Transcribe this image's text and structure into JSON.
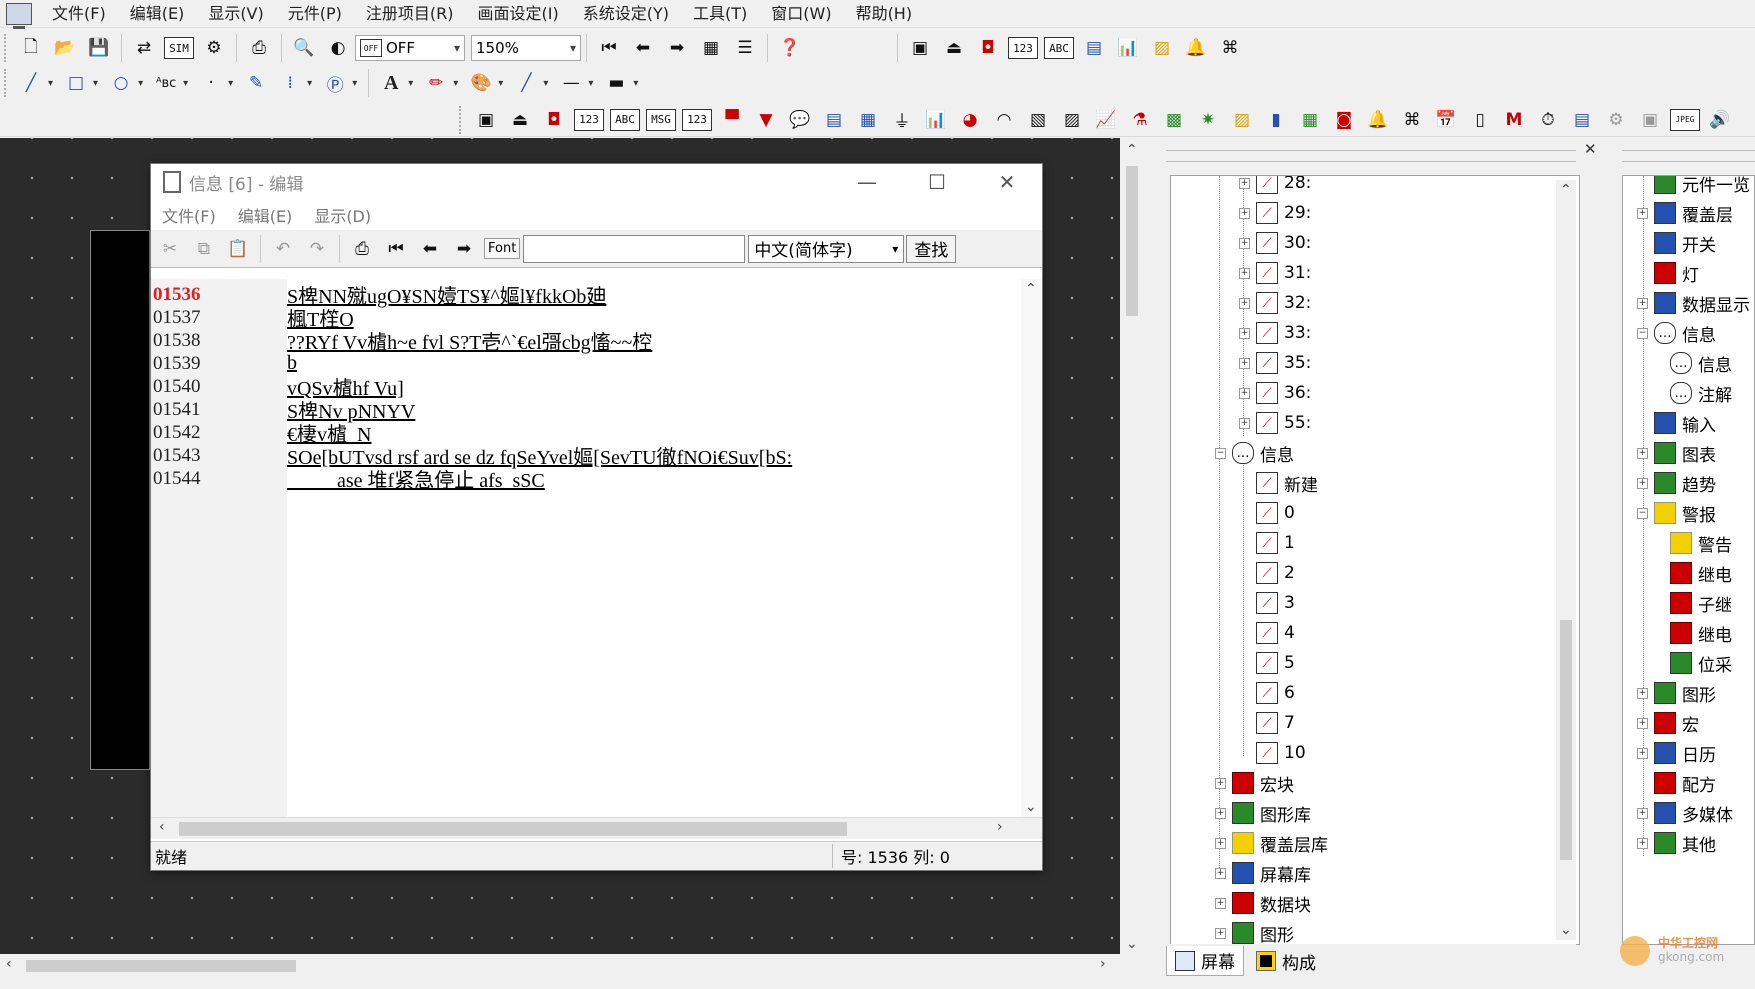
{
  "menu": [
    "文件(F)",
    "编辑(E)",
    "显示(V)",
    "元件(P)",
    "注册项目(R)",
    "画面设定(I)",
    "系统设定(Y)",
    "工具(T)",
    "窗口(W)",
    "帮助(H)"
  ],
  "toolbar": {
    "off_label": "OFF",
    "zoom_value": "150%"
  },
  "editor": {
    "title": "信息 [6] - 编辑",
    "menu": [
      "文件(F)",
      "编辑(E)",
      "显示(D)"
    ],
    "font_label": "Font",
    "find_value": "",
    "lang_value": "中文(简体字)",
    "find_button": "查找",
    "lines": [
      {
        "num": "01536",
        "text": "S椑NN殧ugO¥SN嬄TS¥^嫗l¥fkkOb廸",
        "active": true
      },
      {
        "num": "01537",
        "text": "楓T樦O",
        "active": false
      },
      {
        "num": "01538",
        "text": "??RYf Vv樝h~e fvl S?T壱^`€el彁cbg慉~~椌",
        "active": false
      },
      {
        "num": "01539",
        "text": "b",
        "active": false
      },
      {
        "num": "01540",
        "text": "vQSv樝hf Vu]",
        "active": false
      },
      {
        "num": "01541",
        "text": "S椑Nv pNNYV",
        "active": false
      },
      {
        "num": "01542",
        "text": "€棲v樝_N",
        "active": false
      },
      {
        "num": "01543",
        "text": "SOe[bUTvsd rsf ard se dz fqSeYvel嫗[SevTU徹fNOi€Suv[bS:",
        "active": false
      },
      {
        "num": "01544",
        "text": "          ase 堆f紧急停止 afs  sSC",
        "active": false
      }
    ],
    "status_left": "就绪",
    "status_right": "号: 1536   列: 0"
  },
  "tree": {
    "items": [
      {
        "label": "28:",
        "level": 2,
        "expander": "+",
        "icon": "pen"
      },
      {
        "label": "29:",
        "level": 2,
        "expander": "+",
        "icon": "pen"
      },
      {
        "label": "30:",
        "level": 2,
        "expander": "+",
        "icon": "pen"
      },
      {
        "label": "31:",
        "level": 2,
        "expander": "+",
        "icon": "pen"
      },
      {
        "label": "32:",
        "level": 2,
        "expander": "+",
        "icon": "pen"
      },
      {
        "label": "33:",
        "level": 2,
        "expander": "+",
        "icon": "pen"
      },
      {
        "label": "35:",
        "level": 2,
        "expander": "+",
        "icon": "pen"
      },
      {
        "label": "36:",
        "level": 2,
        "expander": "+",
        "icon": "pen"
      },
      {
        "label": "55:",
        "level": 2,
        "expander": "+",
        "icon": "pen"
      },
      {
        "label": "信息",
        "level": 1,
        "expander": "−",
        "icon": "msg"
      },
      {
        "label": "新建",
        "level": 2,
        "expander": "",
        "icon": "pen"
      },
      {
        "label": "0",
        "level": 2,
        "expander": "",
        "icon": "pen"
      },
      {
        "label": "1",
        "level": 2,
        "expander": "",
        "icon": "pen"
      },
      {
        "label": "2",
        "level": 2,
        "expander": "",
        "icon": "pen"
      },
      {
        "label": "3",
        "level": 2,
        "expander": "",
        "icon": "pen"
      },
      {
        "label": "4",
        "level": 2,
        "expander": "",
        "icon": "pen"
      },
      {
        "label": "5",
        "level": 2,
        "expander": "",
        "icon": "pen"
      },
      {
        "label": "6",
        "level": 2,
        "expander": "",
        "icon": "pen"
      },
      {
        "label": "7",
        "level": 2,
        "expander": "",
        "icon": "pen"
      },
      {
        "label": "10",
        "level": 2,
        "expander": "",
        "icon": "pen"
      },
      {
        "label": "宏块",
        "level": 1,
        "expander": "+",
        "icon": "red"
      },
      {
        "label": "图形库",
        "level": 1,
        "expander": "+",
        "icon": "green"
      },
      {
        "label": "覆盖层库",
        "level": 1,
        "expander": "+",
        "icon": "yellow"
      },
      {
        "label": "屏幕库",
        "level": 1,
        "expander": "+",
        "icon": "blue"
      },
      {
        "label": "数据块",
        "level": 1,
        "expander": "+",
        "icon": "red"
      },
      {
        "label": "图形",
        "level": 1,
        "expander": "+",
        "icon": "green"
      }
    ]
  },
  "tabs": [
    {
      "label": "屏幕",
      "active": true
    },
    {
      "label": "构成",
      "active": false
    }
  ],
  "components": {
    "items": [
      {
        "label": "元件一览",
        "expander": "",
        "icon": "green",
        "indent": 0
      },
      {
        "label": "覆盖层",
        "expander": "+",
        "icon": "blue",
        "indent": 0
      },
      {
        "label": "开关",
        "expander": "",
        "icon": "blue",
        "indent": 0
      },
      {
        "label": "灯",
        "expander": "",
        "icon": "red",
        "indent": 0
      },
      {
        "label": "数据显示",
        "expander": "+",
        "icon": "blue",
        "indent": 0
      },
      {
        "label": "信息",
        "expander": "−",
        "icon": "msg",
        "indent": 0
      },
      {
        "label": "信息",
        "expander": "",
        "icon": "msg",
        "indent": 1
      },
      {
        "label": "注解",
        "expander": "",
        "icon": "msg",
        "indent": 1
      },
      {
        "label": "输入",
        "expander": "",
        "icon": "blue",
        "indent": 0
      },
      {
        "label": "图表",
        "expander": "+",
        "icon": "green",
        "indent": 0
      },
      {
        "label": "趋势",
        "expander": "+",
        "icon": "green",
        "indent": 0
      },
      {
        "label": "警报",
        "expander": "−",
        "icon": "yellow",
        "indent": 0
      },
      {
        "label": "警告",
        "expander": "",
        "icon": "yellow",
        "indent": 1
      },
      {
        "label": "继电",
        "expander": "",
        "icon": "red",
        "indent": 1
      },
      {
        "label": "子继",
        "expander": "",
        "icon": "red",
        "indent": 1
      },
      {
        "label": "继电",
        "expander": "",
        "icon": "red",
        "indent": 1
      },
      {
        "label": "位采",
        "expander": "",
        "icon": "green",
        "indent": 1
      },
      {
        "label": "图形",
        "expander": "+",
        "icon": "green",
        "indent": 0
      },
      {
        "label": "宏",
        "expander": "+",
        "icon": "red",
        "indent": 0
      },
      {
        "label": "日历",
        "expander": "+",
        "icon": "blue",
        "indent": 0
      },
      {
        "label": "配方",
        "expander": "",
        "icon": "red",
        "indent": 0
      },
      {
        "label": "多媒体",
        "expander": "+",
        "icon": "blue",
        "indent": 0
      },
      {
        "label": "其他",
        "expander": "+",
        "icon": "green",
        "indent": 0
      }
    ]
  },
  "watermark": {
    "line1": "中华工控网",
    "line2": "gkong.com"
  }
}
